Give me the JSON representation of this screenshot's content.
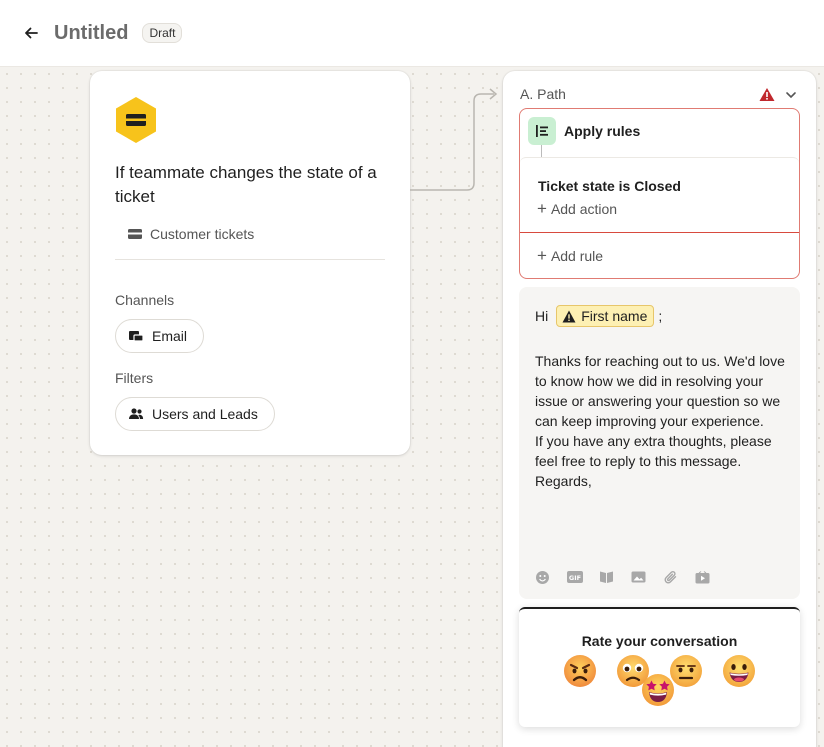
{
  "header": {
    "title": "Untitled",
    "status_badge": "Draft"
  },
  "trigger": {
    "title": "If teammate changes the state of a ticket",
    "source_label": "Customer tickets",
    "channels_label": "Channels",
    "channel": "Email",
    "filters_label": "Filters",
    "filter": "Users and Leads",
    "icon_color": "#f7c31b"
  },
  "path": {
    "label": "A. Path",
    "warning_color": "#c0282d",
    "rules": {
      "title": "Apply rules",
      "rule_text": "Ticket state is Closed",
      "add_action": "Add action",
      "add_rule": "Add rule"
    },
    "message": {
      "greeting": "Hi",
      "attribute": "First name",
      "suffix": ";",
      "body": [
        "Thanks for reaching out to us. We'd love to know how we did in resolving your issue or answering your question so we can keep improving your experience.",
        "If you have any extra thoughts, please feel free to reply to this message.",
        "Regards,"
      ],
      "toolbar": [
        "emoji-icon",
        "gif-icon",
        "article-icon",
        "image-icon",
        "attachment-icon",
        "video-icon"
      ]
    },
    "rating": {
      "title": "Rate your conversation",
      "options": [
        "angry-face",
        "frowning-face",
        "neutral-face",
        "grinning-face",
        "star-struck-face"
      ]
    }
  }
}
